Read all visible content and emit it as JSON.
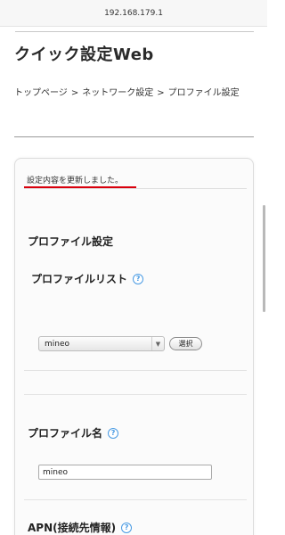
{
  "browser": {
    "url": "192.168.179.1"
  },
  "header": {
    "app_title": "クイック設定Web"
  },
  "breadcrumb": {
    "items": [
      "トップページ",
      "ネットワーク設定",
      "プロファイル設定"
    ],
    "separator": ">"
  },
  "notice": {
    "text": "設定内容を更新しました。",
    "underline_color": "#d9000d"
  },
  "section": {
    "title": "プロファイル設定"
  },
  "profile_list": {
    "label": "プロファイルリスト",
    "help_icon": "question-circle-icon",
    "selected_value": "mineo",
    "select_button_label": "選択"
  },
  "profile_name": {
    "label": "プロファイル名",
    "help_icon": "question-circle-icon",
    "value": "mineo"
  },
  "apn": {
    "label": "APN(接続先情報)",
    "help_icon": "question-circle-icon"
  },
  "colors": {
    "help_icon": "#4a9be3",
    "accent_red": "#d9000d"
  }
}
